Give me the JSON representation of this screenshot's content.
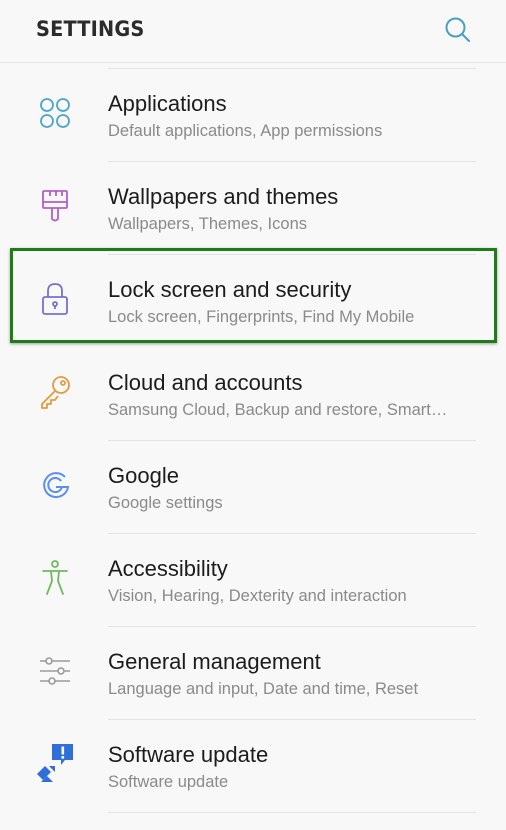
{
  "header": {
    "title": "SETTINGS",
    "search_icon": "search-icon"
  },
  "colors": {
    "highlight_border": "#1e7d16",
    "accent_teal": "#4a9fc0"
  },
  "items": [
    {
      "title": "Applications",
      "subtitle": "Default applications, App permissions",
      "icon": "apps-grid-icon",
      "icon_color": "#4aa5c9"
    },
    {
      "title": "Wallpapers and themes",
      "subtitle": "Wallpapers, Themes, Icons",
      "icon": "paintbrush-icon",
      "icon_color": "#b55ec9"
    },
    {
      "title": "Lock screen and security",
      "subtitle": "Lock screen, Fingerprints, Find My Mobile",
      "icon": "lock-icon",
      "icon_color": "#7a6fd1",
      "highlighted": true
    },
    {
      "title": "Cloud and accounts",
      "subtitle": "Samsung Cloud, Backup and restore, Smart…",
      "icon": "key-icon",
      "icon_color": "#e69a3c"
    },
    {
      "title": "Google",
      "subtitle": "Google settings",
      "icon": "google-icon",
      "icon_color": "#5b8ef0"
    },
    {
      "title": "Accessibility",
      "subtitle": "Vision, Hearing, Dexterity and interaction",
      "icon": "accessibility-person-icon",
      "icon_color": "#6dbb5e"
    },
    {
      "title": "General management",
      "subtitle": "Language and input, Date and time, Reset",
      "icon": "sliders-icon",
      "icon_color": "#9a9a9a"
    },
    {
      "title": "Software update",
      "subtitle": "Software update",
      "icon": "software-update-icon",
      "icon_color": "#2f6fd8"
    }
  ]
}
